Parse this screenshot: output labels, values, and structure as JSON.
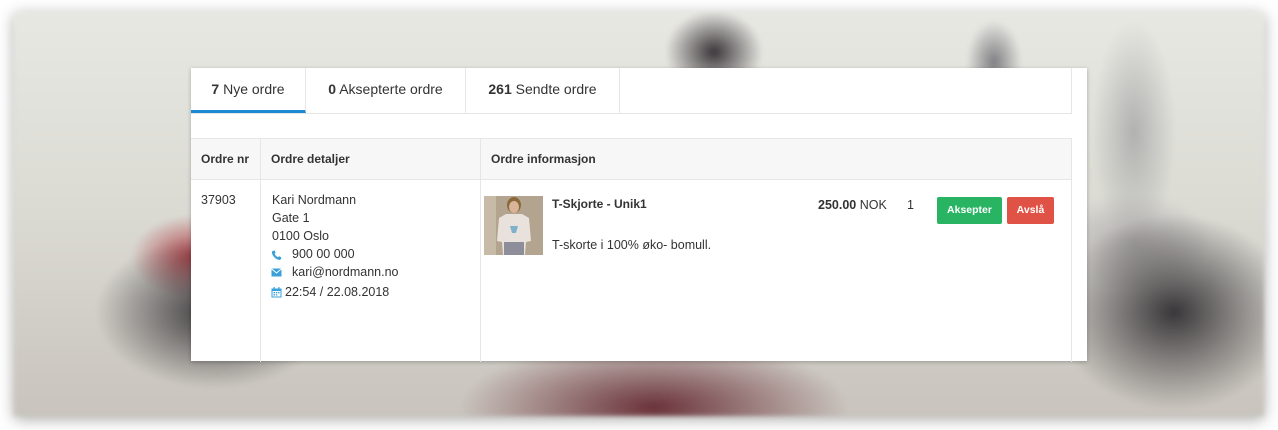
{
  "tabs": [
    {
      "count": "7",
      "label": " Nye ordre"
    },
    {
      "count": "0",
      "label": " Aksepterte ordre"
    },
    {
      "count": "261",
      "label": " Sendte ordre"
    }
  ],
  "table": {
    "headers": {
      "order_nr": "Ordre nr",
      "order_details": "Ordre detaljer",
      "order_info": "Ordre informasjon"
    },
    "row": {
      "order_nr": "37903",
      "customer": {
        "name": "Kari Nordmann",
        "street": "Gate 1",
        "postal": "0100 Oslo",
        "phone": "900 00 000",
        "email": "kari@nordmann.no",
        "datetime": "22:54 / 22.08.2018"
      },
      "product": {
        "name": "T-Skjorte - Unik1",
        "description": "T-skorte i 100% øko- bomull.",
        "price": "250.00",
        "currency": "NOK",
        "quantity": "1"
      },
      "actions": {
        "accept": "Aksepter",
        "reject": "Avslå"
      }
    }
  },
  "icons": {
    "phone": "phone-icon",
    "email": "envelope-icon",
    "date": "calendar-icon"
  },
  "colors": {
    "accent": "#1b8ad3",
    "accept": "#28b463",
    "reject": "#e05245",
    "icon": "#3aa0d8"
  }
}
